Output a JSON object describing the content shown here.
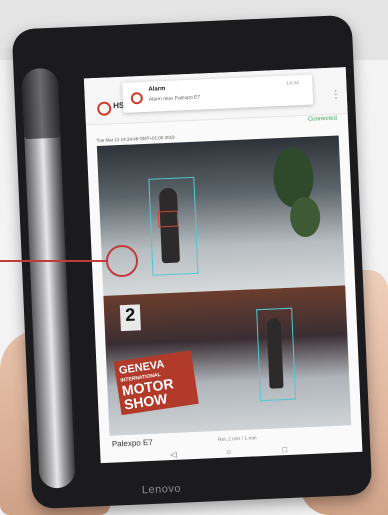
{
  "app": {
    "name": "HS",
    "status": "Connected",
    "timestamp": "Tue Mar 12 14:34:48 GMT+01:00 2019",
    "location_label": "Palexpo E7",
    "footer_center": "Rec 2 min / 1 min"
  },
  "notification": {
    "title": "Alarm",
    "body": "Alarm near Palexpo E7",
    "time": "14:34"
  },
  "scene": {
    "sign_lines": [
      "GENEVA",
      "INTERNATIONAL",
      "MOTOR",
      "SHOW"
    ],
    "sign_number": "2"
  },
  "device": {
    "brand": "Lenovo"
  },
  "navbar": {
    "back": "◁",
    "home": "○",
    "recents": "□"
  },
  "colors": {
    "accent": "#d03a2a",
    "status": "#3aa55a",
    "detection_box": "#4fc9d4",
    "callout": "#c23b3b"
  }
}
